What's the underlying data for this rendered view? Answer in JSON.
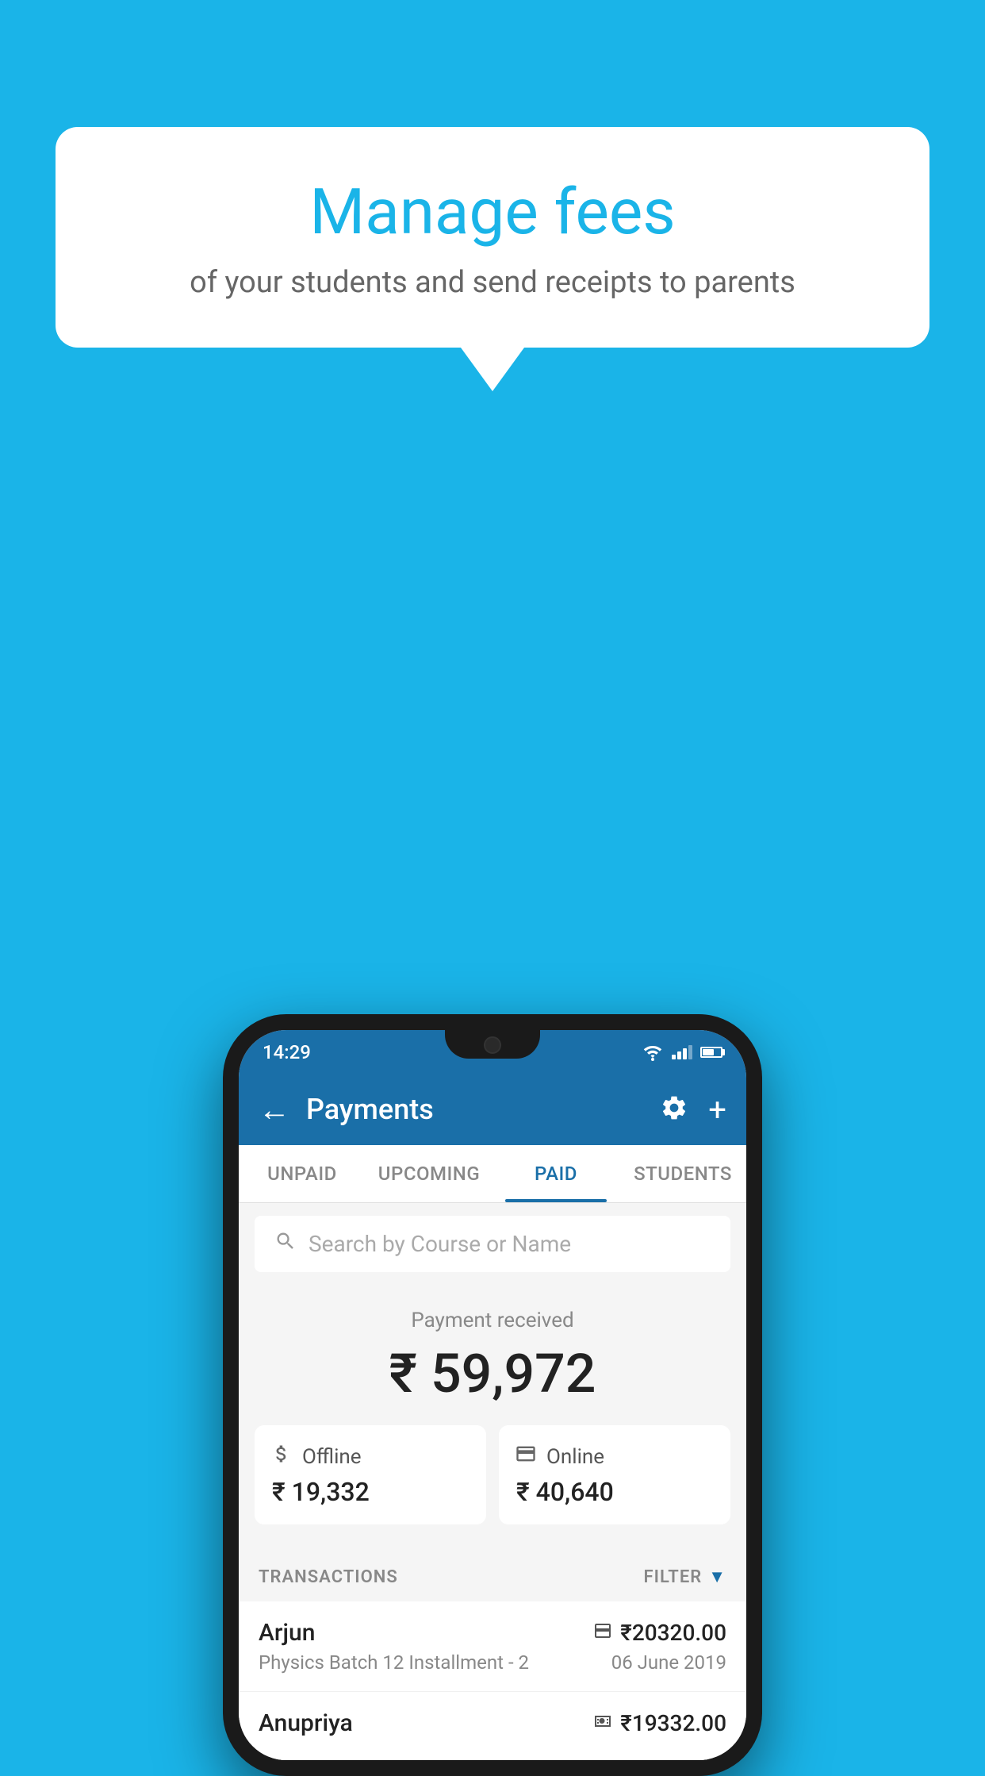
{
  "background_color": "#1ab4e8",
  "speech_bubble": {
    "title": "Manage fees",
    "subtitle": "of your students and send receipts to parents"
  },
  "status_bar": {
    "time": "14:29",
    "wifi": true,
    "signal": true,
    "battery": true
  },
  "app_bar": {
    "title": "Payments",
    "back_label": "←",
    "settings_icon": "gear-icon",
    "add_icon": "plus-icon"
  },
  "tabs": [
    {
      "label": "UNPAID",
      "active": false
    },
    {
      "label": "UPCOMING",
      "active": false
    },
    {
      "label": "PAID",
      "active": true
    },
    {
      "label": "STUDENTS",
      "active": false
    }
  ],
  "search": {
    "placeholder": "Search by Course or Name"
  },
  "payment_summary": {
    "label": "Payment received",
    "amount": "₹ 59,972",
    "offline": {
      "label": "Offline",
      "amount": "₹ 19,332"
    },
    "online": {
      "label": "Online",
      "amount": "₹ 40,640"
    }
  },
  "transactions": {
    "label": "TRANSACTIONS",
    "filter_label": "FILTER",
    "items": [
      {
        "name": "Arjun",
        "detail": "Physics Batch 12 Installment - 2",
        "amount": "₹20320.00",
        "date": "06 June 2019",
        "type": "online"
      },
      {
        "name": "Anupriya",
        "detail": "",
        "amount": "₹19332.00",
        "date": "",
        "type": "offline"
      }
    ]
  }
}
